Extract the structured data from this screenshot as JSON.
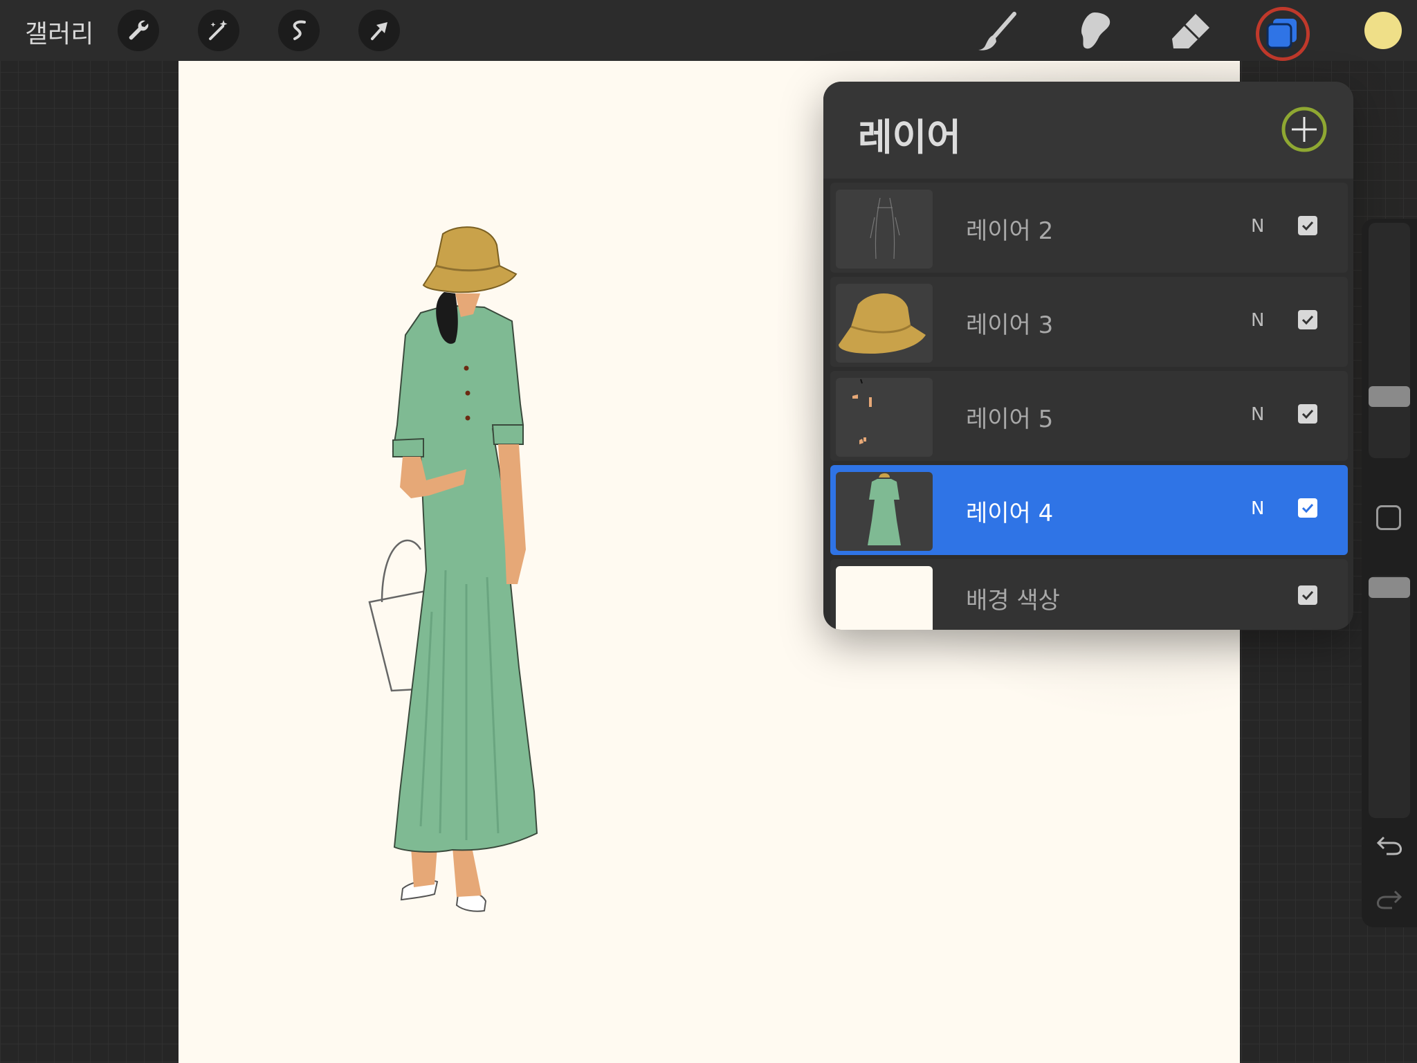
{
  "toolbar": {
    "gallery_label": "갤러리",
    "tools": [
      "wrench-icon",
      "magic-wand-icon",
      "selection-icon",
      "transform-arrow-icon"
    ],
    "right_tools": [
      "brush-icon",
      "smudge-icon",
      "eraser-icon",
      "layers-icon"
    ],
    "current_color": "#efdf88",
    "layers_button_highlight": "#c0392b"
  },
  "layers_panel": {
    "title": "레이어",
    "add_icon_color": "#8fa832",
    "selected_color": "#2f74e6",
    "layers": [
      {
        "name": "레이어 2",
        "blend": "N",
        "visible": true
      },
      {
        "name": "레이어 3",
        "blend": "N",
        "visible": true
      },
      {
        "name": "레이어 5",
        "blend": "N",
        "visible": true
      },
      {
        "name": "레이어 4",
        "blend": "N",
        "visible": true,
        "selected": true
      },
      {
        "name": "배경 색상",
        "visible": true
      }
    ]
  },
  "artwork": {
    "dress_color": "#7fba93",
    "hat_color": "#c9a24a",
    "skin_color": "#e6a877",
    "canvas_color": "#fffaf1"
  }
}
